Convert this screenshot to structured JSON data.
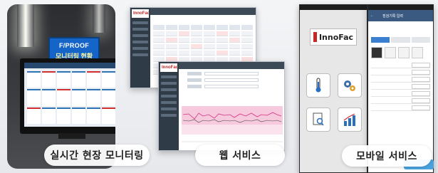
{
  "captions": {
    "realtime": "실시간 현장 모니터링",
    "web": "웹 서비스",
    "mobile": "모바일 서비스"
  },
  "signboard": {
    "line1": "F/PROOF",
    "line2": "모니터링 현황"
  },
  "brand": {
    "name": "InnoFac"
  },
  "mobile_screen": {
    "title": "점검기록 입력"
  },
  "colors": {
    "brand_red": "#c62828",
    "signboard_blue": "#1565c8",
    "web_sidebar": "#2f3b47",
    "mobile_header": "#3b5a82"
  }
}
